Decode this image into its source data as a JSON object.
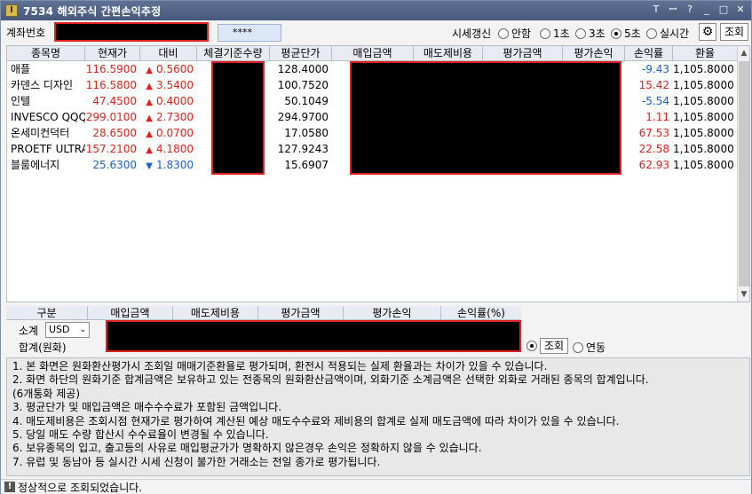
{
  "window": {
    "icon": "I",
    "title": "7534 해외주식 간편손익추정",
    "buttons": [
      "T",
      "ꟷ",
      "?",
      "_",
      "□",
      "✕"
    ]
  },
  "top": {
    "account_label": "계좌번호",
    "password_mask": "****",
    "refresh_label": "시세갱신",
    "refresh_options": [
      {
        "label": "안함",
        "selected": false
      },
      {
        "label": "1초",
        "selected": false
      },
      {
        "label": "3초",
        "selected": false
      },
      {
        "label": "5초",
        "selected": true
      },
      {
        "label": "실시간",
        "selected": false
      }
    ],
    "settings_icon": "gear-icon",
    "query_label": "조회"
  },
  "grid": {
    "headers": [
      "종목명",
      "현재가",
      "대비",
      "체결기준수량",
      "평균단가",
      "매입금액",
      "매도제비용",
      "평가금액",
      "평가손익",
      "손익률",
      "환율"
    ],
    "rows": [
      {
        "name": "애플",
        "price": "116.5900",
        "dir": "up",
        "change": "0.5600",
        "avg": "128.4000",
        "rate": "-9.43",
        "fx": "1,105.8000"
      },
      {
        "name": "카덴스 디자인",
        "price": "116.5800",
        "dir": "up",
        "change": "3.5400",
        "avg": "100.7520",
        "rate": "15.42",
        "fx": "1,105.8000"
      },
      {
        "name": "인텔",
        "price": "47.4500",
        "dir": "up",
        "change": "0.4000",
        "avg": "50.1049",
        "rate": "-5.54",
        "fx": "1,105.8000"
      },
      {
        "name": "INVESCO QQQ T",
        "price": "299.0100",
        "dir": "up",
        "change": "2.7300",
        "avg": "294.9700",
        "rate": "1.11",
        "fx": "1,105.8000"
      },
      {
        "name": "온세미컨덕터",
        "price": "28.6500",
        "dir": "up",
        "change": "0.0700",
        "avg": "17.0580",
        "rate": "67.53",
        "fx": "1,105.8000"
      },
      {
        "name": "PROETF ULTRAP",
        "price": "157.2100",
        "dir": "up",
        "change": "4.1800",
        "avg": "127.9243",
        "rate": "22.58",
        "fx": "1,105.8000"
      },
      {
        "name": "블룸에너지",
        "price": "25.6300",
        "dir": "down",
        "change": "1.8300",
        "avg": "15.6907",
        "rate": "62.93",
        "fx": "1,105.8000"
      }
    ],
    "colors": {
      "up": "#e0201b",
      "down": "#1a5fd0"
    }
  },
  "summary": {
    "headers": [
      "구분",
      "매입금액",
      "매도제비용",
      "평가금액",
      "평가손익",
      "손익률(%)"
    ],
    "subtotal_label": "소계",
    "currency": "USD",
    "total_label": "합계(원화)",
    "mode_options": [
      {
        "label": "조회",
        "selected": true
      },
      {
        "label": "연동",
        "selected": false
      }
    ]
  },
  "notes": [
    "1. 본 화면은 원화환산평가시 조회일 매매기준환율로 평가되며, 환전시 적용되는 실제 환율과는 차이가 있을 수 있습니다.",
    "2. 화면 하단의 원화기준 합계금액은 보유하고 있는 전종목의 원화환산금액이며, 외화기준 소계금액은 선택한 외화로 거래된 종목의 합계입니다.",
    "   (6개통화 제공)",
    "3. 평균단가 및 매입금액은 매수수수료가 포함된 금액입니다.",
    "4. 매도제비용은 조회시점 현재가로 평가하여 계산된 예상 매도수수료와 제비용의 합계로 실제 매도금액에 따라 차이가 있을 수 있습니다.",
    "5. 당일 매도 수량 합산시 수수료율이 변경될 수 있습니다.",
    "6. 보유종목의 입고, 출고등의 사유로 매입평균가가 명확하지 않은경우 손익은 정확하지 않을 수 있습니다.",
    "7. 유럽 및 동남아 등 실시간 시세 신청이 불가한 거래소는 전일 종가로 평가됩니다."
  ],
  "status": {
    "icon": "!",
    "text": "정상적으로 조회되었습니다."
  }
}
